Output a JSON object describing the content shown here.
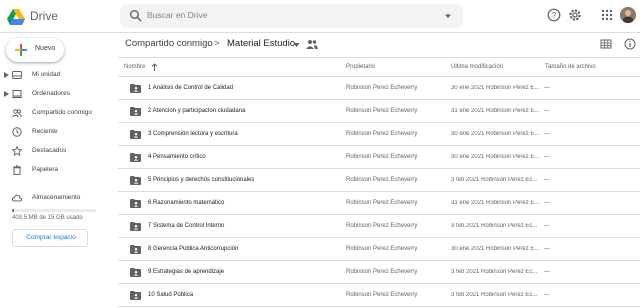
{
  "header": {
    "app_name": "Drive",
    "search_placeholder": "Buscar en Drive",
    "icons": [
      "drive-logo",
      "search-icon",
      "search-options-icon",
      "help-icon",
      "settings-icon",
      "apps-grid-icon",
      "account-avatar"
    ]
  },
  "sidebar": {
    "new_label": "Nuevo",
    "items": [
      {
        "label": "Mi unidad",
        "icon": "my-drive-icon",
        "expandable": true
      },
      {
        "label": "Ordenadores",
        "icon": "computers-icon",
        "expandable": true
      },
      {
        "label": "Compartido conmigo",
        "icon": "shared-icon",
        "expandable": false
      },
      {
        "label": "Reciente",
        "icon": "clock-icon",
        "expandable": false
      },
      {
        "label": "Destacados",
        "icon": "star-icon",
        "expandable": false
      },
      {
        "label": "Papelera",
        "icon": "trash-icon",
        "expandable": false
      },
      {
        "label": "Almacenamiento",
        "icon": "cloud-icon",
        "expandable": false
      }
    ],
    "storage": {
      "text": "403,5 MB de 15 GB usado",
      "used_fraction": 0.027
    },
    "buy_label": "Comprar espacio"
  },
  "breadcrumb": {
    "root": "Compartido conmigo",
    "separator": ">",
    "current": "Material Estudio"
  },
  "table": {
    "headers": {
      "name": "Nombre",
      "owner": "Propietario",
      "modified": "Última modificación",
      "size": "Tamaño de archivo"
    },
    "rows": [
      {
        "name": "1 Análisis de Control de Calidad",
        "owner": "Robinson Perez Echeverry",
        "modified": "30 ene 2021  Robinson Perez E...",
        "size": "—"
      },
      {
        "name": "2 Atencion y participacion ciudadana",
        "owner": "Robinson Perez Echeverry",
        "modified": "31 ene 2021  Robinson Perez E...",
        "size": "—"
      },
      {
        "name": "3 Comprensión lectora y escritura",
        "owner": "Robinson Perez Echeverry",
        "modified": "30 ene 2021  Robinson Perez E...",
        "size": "—"
      },
      {
        "name": "4 Pensamiento crítico",
        "owner": "Robinson Perez Echeverry",
        "modified": "30 ene 2021  Robinson Perez E...",
        "size": "—"
      },
      {
        "name": "5 Principios y derechos constitucionales",
        "owner": "Robinson Perez Echeverry",
        "modified": "3 feb 2021  Robinson Perez Ec...",
        "size": "—"
      },
      {
        "name": "6 Razonamiento matemático",
        "owner": "Robinson Perez Echeverry",
        "modified": "31 ene 2021  Robinson Perez E...",
        "size": "—"
      },
      {
        "name": "7 Sistema de Control Interno",
        "owner": "Robinson Perez Echeverry",
        "modified": "3 feb 2021  Robinson Perez Ec...",
        "size": "—"
      },
      {
        "name": "8 Gerencia Publica Anticorrupción",
        "owner": "Robinson Perez Echeverry",
        "modified": "30 ene 2021  Robinson Perez E...",
        "size": "—"
      },
      {
        "name": "9 Estrategias de aprendizaje",
        "owner": "Robinson Perez Echeverry",
        "modified": "3 feb 2021  Robinson Perez Ec...",
        "size": "—"
      },
      {
        "name": "10 Salud Pública",
        "owner": "Robinson Perez Echeverry",
        "modified": "3 feb 2021  Robinson Perez Ec...",
        "size": "—"
      }
    ]
  },
  "colors": {
    "accent_blue": "#1a73e8",
    "folder_grey": "#5f6368",
    "divider": "#dadce0",
    "search_bg": "#f1f3f4"
  }
}
